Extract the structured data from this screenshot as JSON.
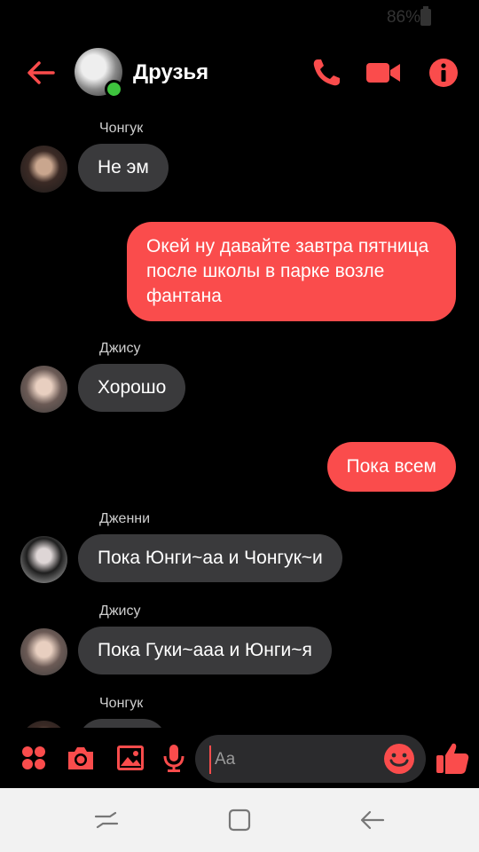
{
  "status": {
    "battery": "86%"
  },
  "header": {
    "title": "Друзья",
    "icons": [
      "back-arrow-icon",
      "group-avatar",
      "phone-icon",
      "video-camera-icon",
      "info-icon"
    ]
  },
  "messages": [
    {
      "type": "in",
      "sender": "Чонгук",
      "text": "Не эм"
    },
    {
      "type": "out",
      "text": "Окей ну давайте завтра пятница после школы в парке возле фантана"
    },
    {
      "type": "in",
      "sender": "Джису",
      "text": "Хорошо"
    },
    {
      "type": "out",
      "text": "Пока всем"
    },
    {
      "type": "in",
      "sender": "Дженни",
      "text": "Пока Юнги~аа и Чонгук~и"
    },
    {
      "type": "in",
      "sender": "Джису",
      "text": "Пока Гуки~ааа и  Юнги~я"
    },
    {
      "type": "in",
      "sender": "Чонгук",
      "text": ""
    }
  ],
  "composer": {
    "placeholder": "Aa",
    "icons": [
      "apps-grid-icon",
      "camera-icon",
      "gallery-icon",
      "microphone-icon",
      "emoji-icon",
      "thumbs-up-icon"
    ]
  },
  "colors": {
    "accent": "#fa4c4c",
    "incoming_bubble": "#3a3a3c",
    "background": "#000000"
  }
}
